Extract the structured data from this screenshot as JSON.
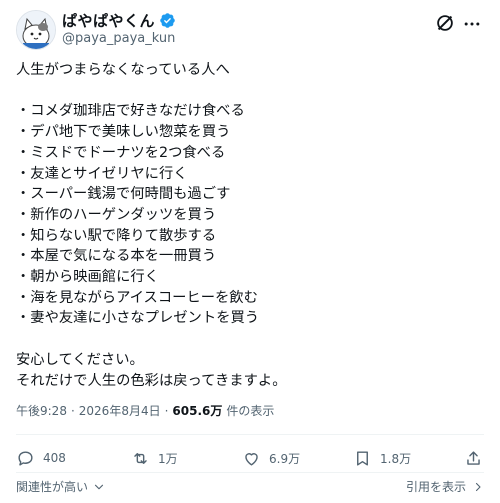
{
  "author": {
    "display_name": "ぱやぱやくん",
    "handle": "@paya_paya_kun",
    "avatar_icon": "cat-avatar-icon",
    "verified_icon": "verified-badge-icon",
    "verified_color": "#1d9bf0"
  },
  "tweet": {
    "text": "人生がつまらなくなっている人へ\n\n・コメダ珈琲店で好きなだけ食べる\n・デパ地下で美味しい惣菜を買う\n・ミスドでドーナツを2つ食べる\n・友達とサイゼリヤに行く\n・スーパー銭湯で何時間も過ごす\n・新作のハーゲンダッツを買う\n・知らない駅で降りて散歩する\n・本屋で気になる本を一冊買う\n・朝から映画館に行く\n・海を見ながらアイスコーヒーを飲む\n・妻や友達に小さなプレゼントを買う\n\n安心してください。\nそれだけで人生の色彩は戻ってきますよ。"
  },
  "meta": {
    "time": "午後9:28",
    "separator": "·",
    "date": "2026年8月4日",
    "views": "605.6万",
    "views_label": "件の表示"
  },
  "actions": {
    "reply_count": "408",
    "repost_count": "1万",
    "like_count": "6.9万",
    "bookmark_count": "1.8万"
  },
  "footer": {
    "sort_label": "関連性が高い",
    "repost_link_label": "引用を表示"
  },
  "colors": {
    "text": "#0f1419",
    "secondary": "#536471",
    "divider": "#eff3f4"
  }
}
